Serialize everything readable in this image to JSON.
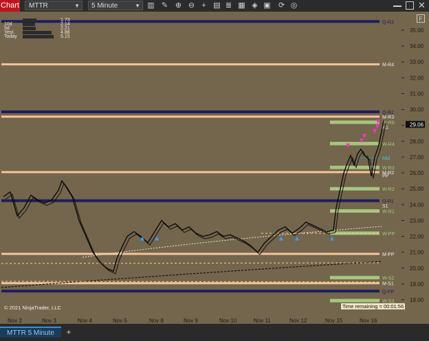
{
  "toolbar": {
    "chart_tab": "Chart",
    "instrument": "MTTR",
    "interval": "5 Minute",
    "icons": [
      "bar-type-icon",
      "pencil-icon",
      "zoom-in-icon",
      "zoom-out-icon",
      "crosshair-icon",
      "template-icon",
      "properties-icon",
      "indicator-icon",
      "strategy-icon",
      "snapshot-icon"
    ]
  },
  "stats": [
    {
      "label": "",
      "value": "1.73"
    },
    {
      "label": "10d",
      "value": "2.14"
    },
    {
      "label": "5d",
      "value": "2.21"
    },
    {
      "label": "Yest.",
      "value": "4.88"
    },
    {
      "label": "Today",
      "value": "5.15"
    }
  ],
  "chart_data": {
    "type": "candlestick",
    "instrument": "MTTR",
    "interval": "5 Minute",
    "x_labels": [
      "Nov 2",
      "Nov 3",
      "Nov 4",
      "Nov 5",
      "Nov 8",
      "Nov 9",
      "Nov 10",
      "Nov 11",
      "Nov 12",
      "Nov 15",
      "Nov 16"
    ],
    "y_ticks": [
      "35.00",
      "34.00",
      "33.00",
      "32.00",
      "31.00",
      "30.00",
      "29.00",
      "28.00",
      "27.00",
      "26.00",
      "25.00",
      "24.00",
      "23.00",
      "22.00",
      "21.00",
      "20.00",
      "19.00",
      "18.00"
    ],
    "ylim": [
      17.5,
      35.5
    ],
    "last_price": "29.06",
    "levels": [
      {
        "label": "Q-R3",
        "price": 35.55,
        "color": "#1c1e5e"
      },
      {
        "label": "M-R4",
        "price": 32.85,
        "color": "#f5c597"
      },
      {
        "label": "Q-R2",
        "price": 29.85,
        "color": "#1c1e5e"
      },
      {
        "label": "M-R3",
        "price": 29.55,
        "color": "#f5c597"
      },
      {
        "label": "W-R5",
        "price": 29.2,
        "color": "#a7c67d"
      },
      {
        "label": "R1",
        "price": 28.9,
        "color": ""
      },
      {
        "label": "W-R4",
        "price": 27.85,
        "color": "#a7c67d"
      },
      {
        "label": "Mid",
        "price": 26.95,
        "color": "#2e9a8e"
      },
      {
        "label": "W-R3",
        "price": 26.35,
        "color": "#a7c67d"
      },
      {
        "label": "M-R2",
        "price": 26.05,
        "color": "#f5c597"
      },
      {
        "label": "PP",
        "price": 25.85,
        "color": ""
      },
      {
        "label": "W-R2",
        "price": 25.0,
        "color": "#a7c67d"
      },
      {
        "label": "Q-R1",
        "price": 24.25,
        "color": "#1c1e5e"
      },
      {
        "label": "S1",
        "price": 23.95,
        "color": ""
      },
      {
        "label": "W-R1",
        "price": 23.6,
        "color": "#a7c67d"
      },
      {
        "label": "W-PP",
        "price": 22.2,
        "color": "#a7c67d"
      },
      {
        "label": "M-PP",
        "price": 20.9,
        "color": "#f5c597"
      },
      {
        "label": "W-S2",
        "price": 19.4,
        "color": "#a7c67d"
      },
      {
        "label": "M-S1",
        "price": 19.05,
        "color": "#f5c597"
      },
      {
        "label": "Q-PP",
        "price": 18.55,
        "color": "#1c1e5e"
      },
      {
        "label": "W-S3",
        "price": 17.95,
        "color": "#a7c67d"
      }
    ],
    "price_path": [
      [
        0,
        24.5
      ],
      [
        10,
        24.8
      ],
      [
        20,
        23.3
      ],
      [
        30,
        23.8
      ],
      [
        40,
        24.6
      ],
      [
        50,
        24.3
      ],
      [
        60,
        24.1
      ],
      [
        70,
        24.3
      ],
      [
        80,
        24.9
      ],
      [
        85,
        25.5
      ],
      [
        90,
        25.2
      ],
      [
        100,
        24.5
      ],
      [
        110,
        23.0
      ],
      [
        120,
        22.0
      ],
      [
        125,
        21.5
      ],
      [
        130,
        21.0
      ],
      [
        140,
        20.4
      ],
      [
        150,
        20.0
      ],
      [
        160,
        19.8
      ],
      [
        165,
        20.6
      ],
      [
        170,
        21.1
      ],
      [
        180,
        22.0
      ],
      [
        190,
        22.3
      ],
      [
        200,
        22.0
      ],
      [
        210,
        21.6
      ],
      [
        220,
        22.3
      ],
      [
        230,
        23.0
      ],
      [
        240,
        22.6
      ],
      [
        250,
        22.8
      ],
      [
        260,
        22.4
      ],
      [
        270,
        22.6
      ],
      [
        280,
        22.2
      ],
      [
        290,
        22.0
      ],
      [
        300,
        22.1
      ],
      [
        310,
        22.3
      ],
      [
        320,
        22.0
      ],
      [
        330,
        22.1
      ],
      [
        340,
        21.9
      ],
      [
        350,
        21.7
      ],
      [
        360,
        21.4
      ],
      [
        370,
        21.0
      ],
      [
        380,
        21.6
      ],
      [
        390,
        22.0
      ],
      [
        400,
        22.4
      ],
      [
        410,
        22.6
      ],
      [
        420,
        22.2
      ],
      [
        430,
        22.5
      ],
      [
        440,
        22.9
      ],
      [
        450,
        22.7
      ],
      [
        460,
        22.5
      ],
      [
        470,
        22.3
      ],
      [
        480,
        22.4
      ],
      [
        484,
        23.8
      ],
      [
        490,
        25.0
      ],
      [
        495,
        26.0
      ],
      [
        500,
        26.6
      ],
      [
        505,
        27.1
      ],
      [
        510,
        26.5
      ],
      [
        515,
        27.2
      ],
      [
        520,
        27.5
      ],
      [
        525,
        27.1
      ],
      [
        530,
        27.0
      ],
      [
        535,
        25.8
      ],
      [
        540,
        27.0
      ],
      [
        545,
        27.6
      ],
      [
        550,
        28.6
      ],
      [
        553,
        29.3
      ]
    ],
    "up_markers": [
      207,
      228,
      409,
      432,
      483
    ],
    "down_markers": [
      506,
      526,
      530,
      545,
      549,
      550
    ]
  },
  "footer": {
    "copyright": "© 2021 NinjaTrader, LLC",
    "time_remaining": "Time remaining = 00:01:56",
    "bottom_tab": "MTTR 5 Minute",
    "add_tab": "+",
    "f_button": "F"
  }
}
